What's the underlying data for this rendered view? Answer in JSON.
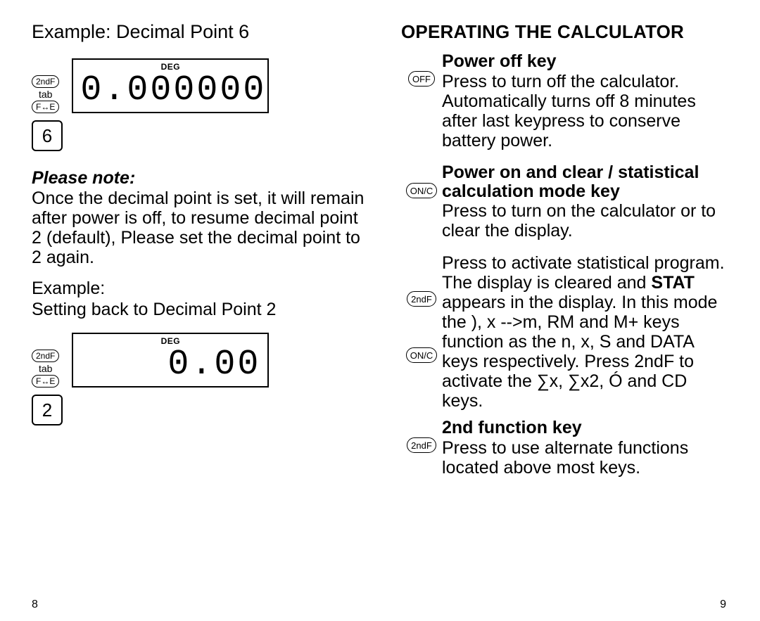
{
  "left": {
    "title": "Example: Decimal Point 6",
    "cluster1": {
      "key_2ndf": "2ndF",
      "tab_label": "tab",
      "key_fe": "F↔E",
      "lcd_mode": "DEG",
      "lcd_value": "0.000000",
      "key_digit": "6"
    },
    "note_heading": "Please note:",
    "note_body": "Once the decimal point is set, it will remain after power is off, to resume decimal point 2 (default), Please set the decimal point to 2 again.",
    "example_label": "Example:",
    "example_body": "Setting back to Decimal Point 2",
    "cluster2": {
      "key_2ndf": "2ndF",
      "tab_label": "tab",
      "key_fe": "F↔E",
      "lcd_mode": "DEG",
      "lcd_value": "0.00",
      "key_digit": "2"
    },
    "page_number": "8"
  },
  "right": {
    "section_heading": "OPERATING THE CALCULATOR",
    "power_off": {
      "heading": "Power off key",
      "key_label": "OFF",
      "body": "Press to turn off the calculator. Automatically turns off 8 minutes after last keypress to conserve battery power."
    },
    "on_c": {
      "heading": "Power on and clear / statistical calculation mode key",
      "key_label": "ON/C",
      "body1": "Press to turn on the calculator or to clear the display.",
      "key_2ndf": "2ndF",
      "key_onc2": "ON/C",
      "body2_pre": "Press to activate statistical program. The display is cleared and ",
      "body2_bold": "STAT",
      "body2_post": " appears in the display. In this mode the ), x -->m, RM and M+ keys function as the n, x, S and DATA keys respectively. Press 2ndF to activate the  ∑x, ∑x2, Ó and CD keys."
    },
    "second_fn": {
      "heading": "2nd function key",
      "key_label": "2ndF",
      "body": "Press to use alternate functions located above most keys."
    },
    "page_number": "9"
  }
}
